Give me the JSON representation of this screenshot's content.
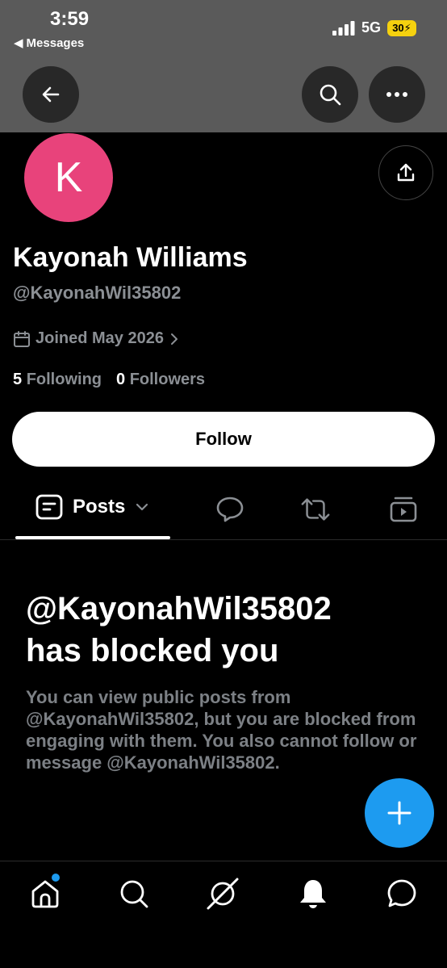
{
  "status_bar": {
    "time": "3:59",
    "back_app": "Messages",
    "network": "5G",
    "battery": "30"
  },
  "profile": {
    "avatar_letter": "K",
    "name": "Kayonah Williams",
    "handle": "@KayonahWil35802",
    "joined": "Joined May 2026",
    "following_count": "5",
    "following_label": "Following",
    "followers_count": "0",
    "followers_label": "Followers",
    "follow_label": "Follow",
    "avatar_color": "#e8437b"
  },
  "tabs": {
    "posts_label": "Posts"
  },
  "blocked": {
    "title_line1": "@KayonahWil35802",
    "title_line2": "has blocked you",
    "description": "You can view public posts from @KayonahWil35802, but you are blocked from engaging with them. You also cannot follow or message @KayonahWil35802."
  },
  "colors": {
    "accent": "#1d9bf0",
    "muted_text": "#8b8f94"
  },
  "icons": [
    "back-arrow-icon",
    "search-icon",
    "more-icon",
    "share-icon",
    "calendar-icon",
    "chevron-right-icon",
    "posts-icon",
    "chevron-down-icon",
    "replies-icon",
    "reposts-icon",
    "media-icon",
    "plus-icon",
    "home-icon",
    "explore-icon",
    "grok-icon",
    "bell-icon",
    "messages-icon"
  ]
}
